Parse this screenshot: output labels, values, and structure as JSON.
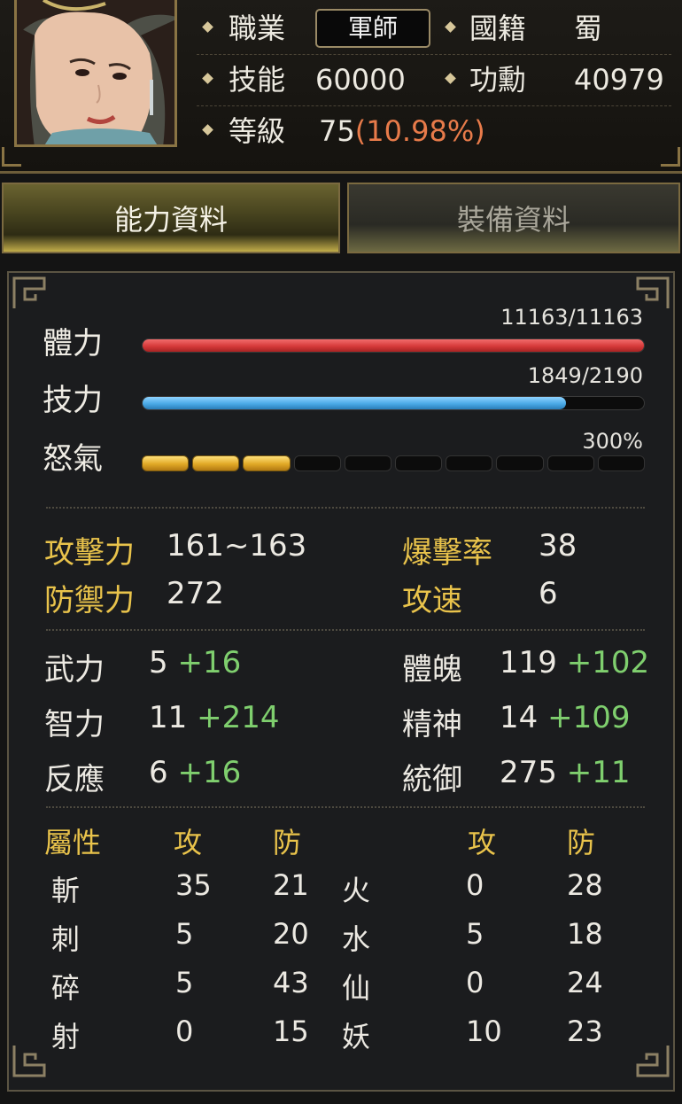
{
  "header": {
    "job_label": "職業",
    "job_value": "軍師",
    "nation_label": "國籍",
    "nation_value": "蜀",
    "skill_label": "技能",
    "skill_value": "60000",
    "merit_label": "功勳",
    "merit_value": "40979",
    "level_label": "等級",
    "level_value": "75",
    "level_pct": "(10.98%)"
  },
  "tabs": [
    {
      "label": "能力資料",
      "active": true
    },
    {
      "label": "裝備資料",
      "active": false
    }
  ],
  "bars": {
    "hp": {
      "label": "體力",
      "text": "11163/11163",
      "current": 11163,
      "max": 11163
    },
    "mp": {
      "label": "技力",
      "text": "1849/2190",
      "current": 1849,
      "max": 2190
    },
    "rage": {
      "label": "怒氣",
      "text": "300%",
      "filled": 3,
      "segments": 10
    }
  },
  "combat": {
    "attack_label": "攻擊力",
    "attack_value": "161~163",
    "crit_label": "爆擊率",
    "crit_value": "38",
    "defense_label": "防禦力",
    "defense_value": "272",
    "speed_label": "攻速",
    "speed_value": "6"
  },
  "attributes": {
    "str": {
      "label": "武力",
      "base": "5",
      "bonus": "+16"
    },
    "int": {
      "label": "智力",
      "base": "11",
      "bonus": "+214"
    },
    "agi": {
      "label": "反應",
      "base": "6",
      "bonus": "+16"
    },
    "con": {
      "label": "體魄",
      "base": "119",
      "bonus": "+102"
    },
    "spi": {
      "label": "精神",
      "base": "14",
      "bonus": "+109"
    },
    "lead": {
      "label": "統御",
      "base": "275",
      "bonus": "+11"
    }
  },
  "elements": {
    "header_attr": "屬性",
    "header_atk": "攻",
    "header_def": "防",
    "left": [
      {
        "name": "斬",
        "atk": "35",
        "def": "21"
      },
      {
        "name": "刺",
        "atk": "5",
        "def": "20"
      },
      {
        "name": "碎",
        "atk": "5",
        "def": "43"
      },
      {
        "name": "射",
        "atk": "0",
        "def": "15"
      }
    ],
    "right": [
      {
        "name": "火",
        "atk": "0",
        "def": "28"
      },
      {
        "name": "水",
        "atk": "5",
        "def": "18"
      },
      {
        "name": "仙",
        "atk": "0",
        "def": "24"
      },
      {
        "name": "妖",
        "atk": "10",
        "def": "23"
      }
    ]
  },
  "colors": {
    "gold_label": "#e9c34b",
    "bonus_green": "#7fcf6e",
    "level_pct": "#e87b4a",
    "hp_bar": "#d63a3a",
    "mp_bar": "#4aa9e6",
    "rage_bar": "#e0a826"
  }
}
